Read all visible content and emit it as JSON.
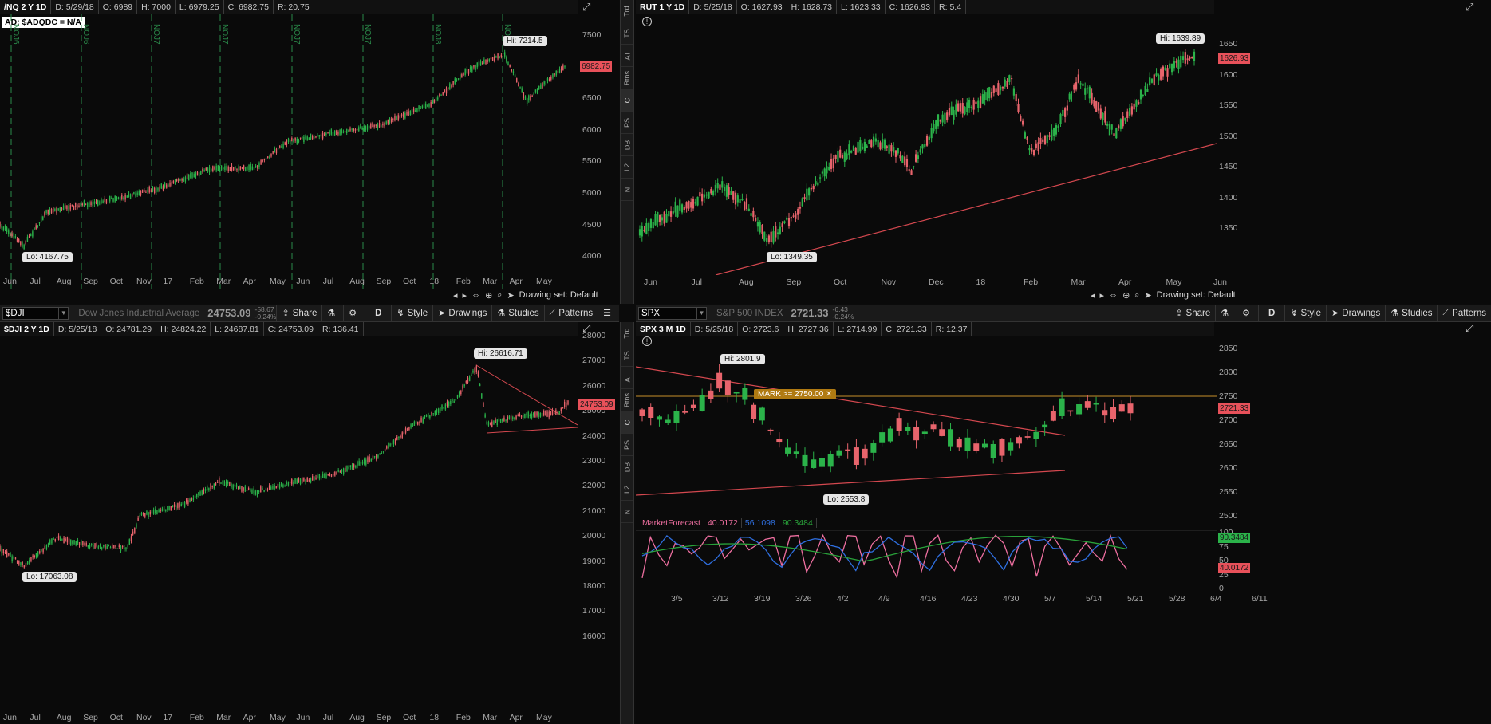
{
  "colors": {
    "up": "#2bb34a",
    "down": "#e8646c",
    "trend": "#d4484f",
    "mark": "#c8902a",
    "mf_pink": "#ee6fa0",
    "mf_blue": "#2f6fe0",
    "mf_green": "#29a23a"
  },
  "panel_nq": {
    "info": {
      "sym": "/NQ 2 Y 1D",
      "d": "D: 5/29/18",
      "o": "O: 6989",
      "h": "H: 7000",
      "l": "L: 6979.25",
      "c": "C: 6982.75",
      "r": "R: 20.75"
    },
    "ad_label": "AD: $ADQDC = N/A",
    "yticks": [
      "7500",
      "7000",
      "6500",
      "6000",
      "5500",
      "5000",
      "4500",
      "4000"
    ],
    "xticks": [
      "Jun",
      "Jul",
      "Aug",
      "Sep",
      "Oct",
      "Nov",
      "17",
      "Feb",
      "Mar",
      "Apr",
      "May",
      "Jun",
      "Jul",
      "Aug",
      "Sep",
      "Oct",
      "18",
      "Feb",
      "Mar",
      "Apr",
      "May"
    ],
    "price": "6982.75",
    "hi": "Hi: 7214.5",
    "lo": "Lo: 4167.75",
    "vlines": [
      "NOJ6",
      "NOJ6",
      "NOJ7",
      "NOJ7",
      "NOJ7",
      "NOJ7",
      "NOJ8",
      "NOJ8"
    ],
    "drawing_set": "Drawing set: Default"
  },
  "panel_rut": {
    "info": {
      "sym": "RUT 1 Y 1D",
      "d": "D: 5/25/18",
      "o": "O: 1627.93",
      "h": "H: 1628.73",
      "l": "L: 1623.33",
      "c": "C: 1626.93",
      "r": "R: 5.4"
    },
    "yticks": [
      "1650",
      "1600",
      "1550",
      "1500",
      "1450",
      "1400",
      "1350"
    ],
    "xticks": [
      "Jun",
      "Jul",
      "Aug",
      "Sep",
      "Oct",
      "Nov",
      "Dec",
      "18",
      "Feb",
      "Mar",
      "Apr",
      "May",
      "Jun"
    ],
    "price": "1626.93",
    "hi": "Hi: 1639.89",
    "lo": "Lo: 1349.35",
    "drawing_set": "Drawing set: Default"
  },
  "panel_dji": {
    "toolbar": {
      "symbol": "$DJI",
      "desc": "Dow Jones Industrial Average",
      "last": "24753.09",
      "chg": "-58.67",
      "chg_pct": "-0.24%",
      "share": "Share",
      "agg": "D",
      "style": "Style",
      "drawings": "Drawings",
      "studies": "Studies",
      "patterns": "Patterns"
    },
    "info": {
      "sym": "$DJI 2 Y 1D",
      "d": "D: 5/25/18",
      "o": "O: 24781.29",
      "h": "H: 24824.22",
      "l": "L: 24687.81",
      "c": "C: 24753.09",
      "r": "R: 136.41"
    },
    "yticks": [
      "28000",
      "27000",
      "26000",
      "25000",
      "24000",
      "23000",
      "22000",
      "21000",
      "20000",
      "19000",
      "18000",
      "17000",
      "16000"
    ],
    "xticks": [
      "Jun",
      "Jul",
      "Aug",
      "Sep",
      "Oct",
      "Nov",
      "17",
      "Feb",
      "Mar",
      "Apr",
      "May",
      "Jun",
      "Jul",
      "Aug",
      "Sep",
      "Oct",
      "18",
      "Feb",
      "Mar",
      "Apr",
      "May"
    ],
    "price": "24753.09",
    "hi": "Hi: 26616.71",
    "lo": "Lo: 17063.08"
  },
  "panel_spx": {
    "toolbar": {
      "symbol": "SPX",
      "desc": "S&P 500 INDEX",
      "last": "2721.33",
      "chg": "-6.43",
      "chg_pct": "-0.24%",
      "share": "Share",
      "agg": "D",
      "style": "Style",
      "drawings": "Drawings",
      "studies": "Studies",
      "patterns": "Patterns"
    },
    "info": {
      "sym": "SPX 3 M 1D",
      "d": "D: 5/25/18",
      "o": "O: 2723.6",
      "h": "H: 2727.36",
      "l": "L: 2714.99",
      "c": "C: 2721.33",
      "r": "R: 12.37"
    },
    "yticks": [
      "2850",
      "2800",
      "2750",
      "2700",
      "2650",
      "2600",
      "2550",
      "2500"
    ],
    "xticks": [
      "3/5",
      "3/12",
      "3/19",
      "3/26",
      "4/2",
      "4/9",
      "4/16",
      "4/23",
      "4/30",
      "5/7",
      "5/14",
      "5/21",
      "5/28",
      "6/4",
      "6/11"
    ],
    "price": "2721.33",
    "hi": "Hi: 2801.9",
    "lo": "Lo: 2553.8",
    "mark": "MARK >= 2750.00 ✕",
    "mf": {
      "name": "MarketForecast",
      "v1": "40.0172",
      "v2": "56.1098",
      "v3": "90.3484",
      "yticks": [
        "100",
        "75",
        "50",
        "25",
        "0"
      ],
      "tag_hi": "90.3484",
      "tag_lo": "40.0172"
    }
  },
  "sidetabs": [
    "Trd",
    "TS",
    "AT",
    "Btns",
    "C",
    "PS",
    "DB",
    "L2",
    "N"
  ]
}
